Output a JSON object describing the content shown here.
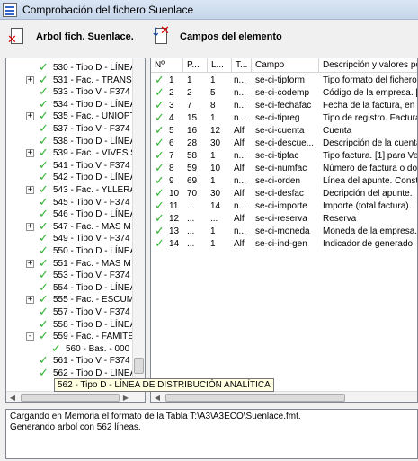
{
  "window": {
    "title": "Comprobación del fichero Suenlace"
  },
  "toolbar": {
    "tree_button_label": "Arbol fich. Suenlace.",
    "fields_button_label": "Campos del elemento"
  },
  "tree": {
    "items": [
      {
        "label": "530 - Tipo D - LÍNEA",
        "expander": "",
        "level": 0
      },
      {
        "label": "531 - Fac. - TRANS",
        "expander": "+",
        "level": 0
      },
      {
        "label": "533 - Tipo V - F374",
        "expander": "",
        "level": 0
      },
      {
        "label": "534 - Tipo D - LÍNEA",
        "expander": "",
        "level": 0
      },
      {
        "label": "535 - Fac. - UNIOPT",
        "expander": "+",
        "level": 0
      },
      {
        "label": "537 - Tipo V - F374",
        "expander": "",
        "level": 0
      },
      {
        "label": "538 - Tipo D - LÍNEA",
        "expander": "",
        "level": 0
      },
      {
        "label": "539 - Fac. - VIVES S",
        "expander": "+",
        "level": 0
      },
      {
        "label": "541 - Tipo V - F374",
        "expander": "",
        "level": 0
      },
      {
        "label": "542 - Tipo D - LÍNEA",
        "expander": "",
        "level": 0
      },
      {
        "label": "543 - Fac. - YLLERA",
        "expander": "+",
        "level": 0
      },
      {
        "label": "545 - Tipo V - F374",
        "expander": "",
        "level": 0
      },
      {
        "label": "546 - Tipo D - LÍNEA",
        "expander": "",
        "level": 0
      },
      {
        "label": "547 - Fac. - MAS M",
        "expander": "+",
        "level": 0
      },
      {
        "label": "549 - Tipo V - F374",
        "expander": "",
        "level": 0
      },
      {
        "label": "550 - Tipo D - LÍNEA",
        "expander": "",
        "level": 0
      },
      {
        "label": "551 - Fac. - MAS M",
        "expander": "+",
        "level": 0
      },
      {
        "label": "553 - Tipo V - F374",
        "expander": "",
        "level": 0
      },
      {
        "label": "554 - Tipo D - LÍNEA",
        "expander": "",
        "level": 0
      },
      {
        "label": "555 - Fac. - ESCUM",
        "expander": "+",
        "level": 0
      },
      {
        "label": "557 - Tipo V - F374",
        "expander": "",
        "level": 0
      },
      {
        "label": "558 - Tipo D - LÍNEA",
        "expander": "",
        "level": 0
      },
      {
        "label": "559 - Fac. - FAMITE",
        "expander": "-",
        "level": 0
      },
      {
        "label": "560 - Bas. - 000",
        "expander": "",
        "level": 1
      },
      {
        "label": "561 - Tipo V - F374",
        "expander": "",
        "level": 0
      },
      {
        "label": "562 - Tipo D - LÍNEA",
        "expander": "",
        "level": 0
      }
    ],
    "tooltip": "562 - Tipo D - LÍNEA DE DISTRIBUCIÓN ANALÍTICA"
  },
  "grid": {
    "columns": [
      "Nº",
      "P...",
      "L...",
      "T...",
      "Campo",
      "Descripción y valores pos"
    ],
    "rows": [
      [
        "1",
        "1",
        "1",
        "n...",
        "se-ci-tipform",
        "Tipo formato del fichero. C"
      ],
      [
        "2",
        "2",
        "5",
        "n...",
        "se-ci-codemp",
        "Código de la empresa. [1 -"
      ],
      [
        "3",
        "7",
        "8",
        "n...",
        "se-ci-fechafac",
        "Fecha de la factura, en for"
      ],
      [
        "4",
        "15",
        "1",
        "n...",
        "se-ci-tipreg",
        "Tipo de registro. Facturas"
      ],
      [
        "5",
        "16",
        "12",
        "Alf",
        "se-ci-cuenta",
        "Cuenta"
      ],
      [
        "6",
        "28",
        "30",
        "Alf",
        "se-ci-descue...",
        "Descripción de la cuenta"
      ],
      [
        "7",
        "58",
        "1",
        "n...",
        "se-ci-tipfac",
        "Tipo factura. [1] para Ven"
      ],
      [
        "8",
        "59",
        "10",
        "Alf",
        "se-ci-numfac",
        "Número de factura o docu"
      ],
      [
        "9",
        "69",
        "1",
        "n...",
        "se-ci-orden",
        "Línea del apunte. Constan"
      ],
      [
        "10",
        "70",
        "30",
        "Alf",
        "se-ci-desfac",
        "Decripción del apunte."
      ],
      [
        "11",
        "...",
        "14",
        "n...",
        "se-ci-importe",
        "Importe (total factura)."
      ],
      [
        "12",
        "...",
        "...",
        "Alf",
        "se-ci-reserva",
        "Reserva"
      ],
      [
        "13",
        "...",
        "1",
        "n...",
        "se-ci-moneda",
        "Moneda de la empresa. \"E"
      ],
      [
        "14",
        "...",
        "1",
        "Alf",
        "se-ci-ind-gen",
        "Indicador de generado."
      ]
    ]
  },
  "log": {
    "lines": [
      "Cargando en Memoria el formato de la Tabla T:\\A3\\A3ECO\\Suenlace.fmt.",
      "Generando arbol con 562 líneas."
    ]
  },
  "icons": {
    "app": "document-list-icon",
    "tree_button": "document-delete-icon",
    "fields_button": "document-download-delete-icon",
    "check": "green-check-icon"
  },
  "colors": {
    "check": "#2fb52f",
    "delete_mark": "#dd0000",
    "tooltip_bg": "#ffffe1"
  }
}
